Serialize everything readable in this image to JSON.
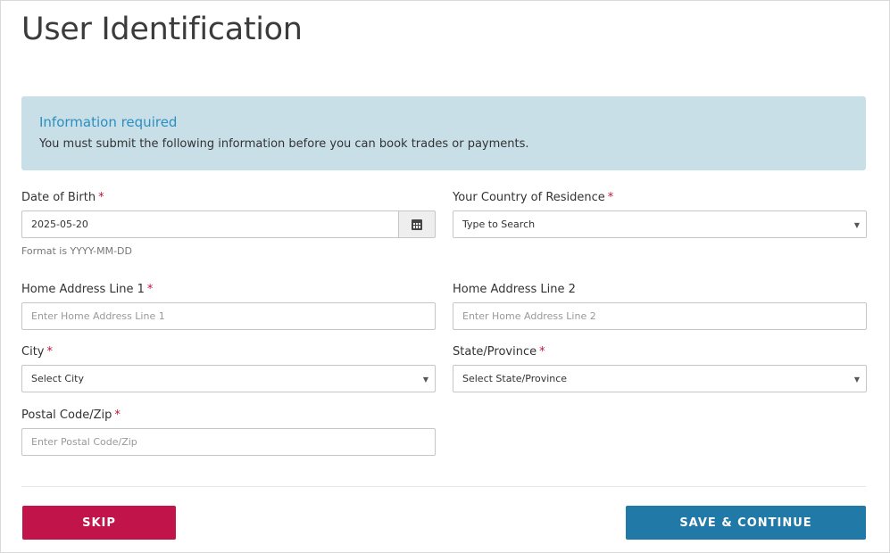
{
  "page": {
    "title": "User Identification"
  },
  "alert": {
    "title": "Information required",
    "text": "You must submit the following information before you can book trades or payments."
  },
  "form": {
    "required_marker": "*",
    "date_of_birth": {
      "label": "Date of Birth",
      "value": "2025-05-20",
      "help": "Format is YYYY-MM-DD",
      "icon": "calendar-icon"
    },
    "country": {
      "label": "Your Country of Residence",
      "value": "Type to Search",
      "arrow": "▼"
    },
    "address1": {
      "label": "Home Address Line 1",
      "placeholder": "Enter Home Address Line 1"
    },
    "address2": {
      "label": "Home Address Line 2",
      "placeholder": "Enter Home Address Line 2"
    },
    "city": {
      "label": "City",
      "value": "Select City",
      "arrow": "▼"
    },
    "state": {
      "label": "State/Province",
      "value": "Select State/Province",
      "arrow": "▼"
    },
    "postal": {
      "label": "Postal Code/Zip",
      "placeholder": "Enter Postal Code/Zip"
    }
  },
  "actions": {
    "skip_label": "SKIP",
    "save_label": "SAVE & CONTINUE"
  },
  "colors": {
    "alert_bg": "#c8dfe8",
    "alert_title": "#2c8ec0",
    "required": "#c0143c",
    "skip_button": "#c0144a",
    "save_button": "#2079a7"
  }
}
